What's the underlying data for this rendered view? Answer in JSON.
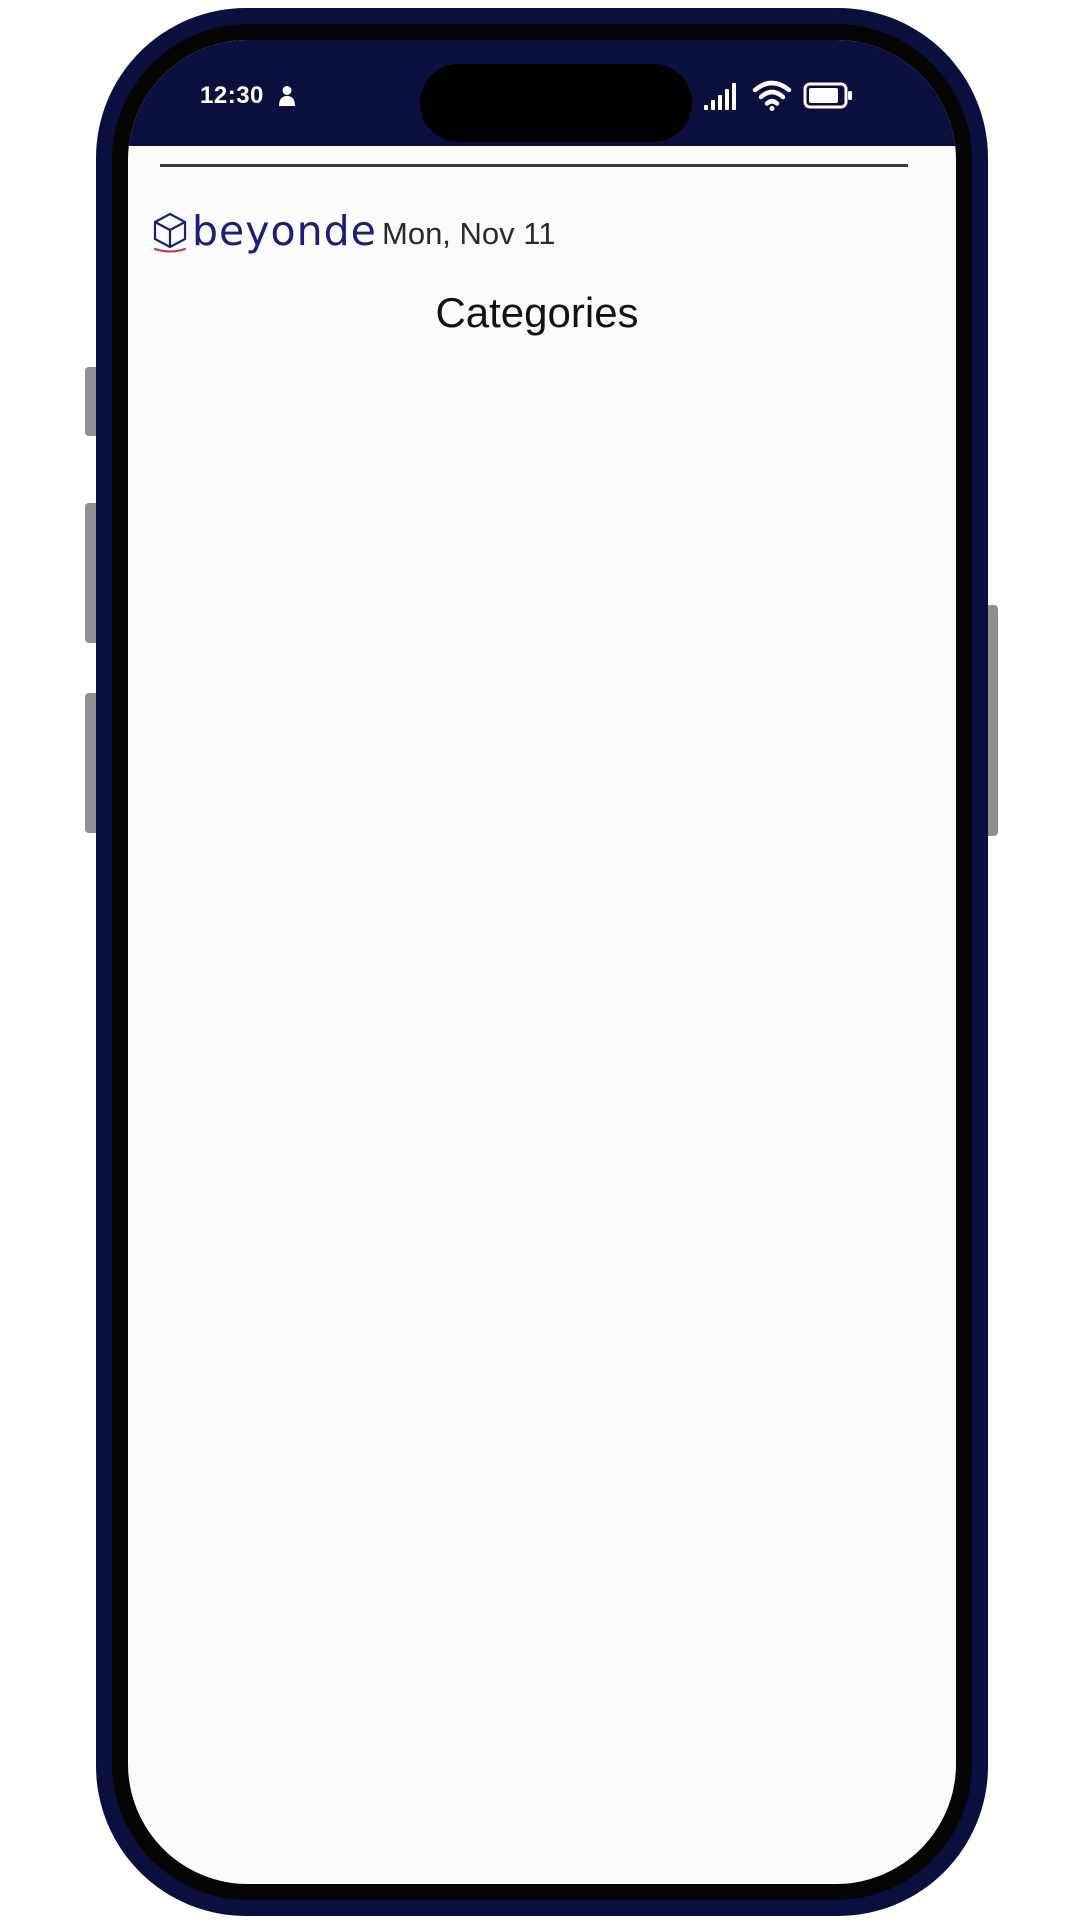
{
  "status_bar": {
    "time": "12:30",
    "icons": [
      "person-icon",
      "signal-icon",
      "wifi-icon",
      "battery-icon"
    ],
    "background_color": "#0b0f3d"
  },
  "header": {
    "brand": "beyonde",
    "brand_color": "#1a1f7a",
    "date": "Mon, Nov 11",
    "title": "Categories"
  }
}
